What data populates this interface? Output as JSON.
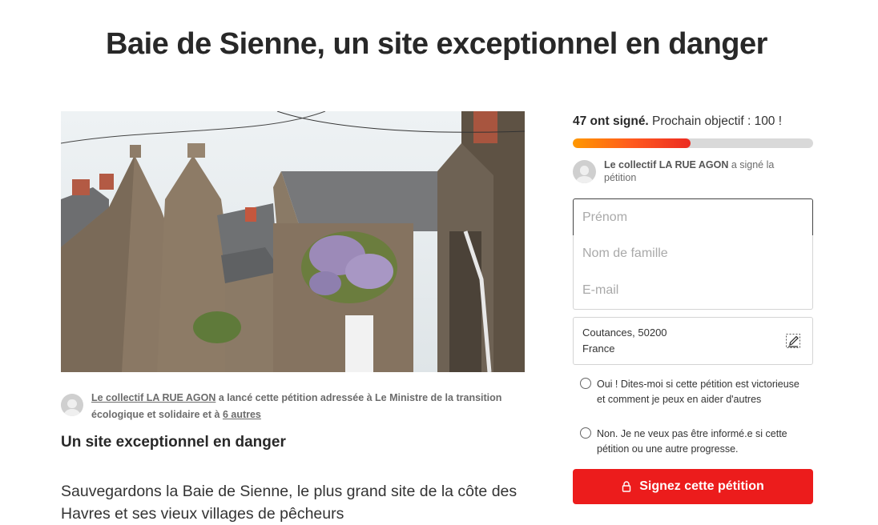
{
  "page": {
    "title": "Baie de Sienne, un site exceptionnel en danger"
  },
  "petition": {
    "starter_name": "Le collectif LA RUE AGON",
    "starter_text_mid": " a lancé cette pétition adressée à Le Ministre de la transition écologique et solidaire et à ",
    "starter_others": "6 autres",
    "subtitle": "Un site exceptionnel en danger",
    "body": "Sauvegardons la Baie de Sienne, le plus grand site de la côte des Havres et ses vieux villages de pêcheurs"
  },
  "signatures": {
    "count_label": "47 ont signé.",
    "goal_label": " Prochain objectif : 100 !",
    "progress": 0.49,
    "recent_name": "Le collectif LA RUE AGON",
    "recent_action": " a signé la pétition"
  },
  "form": {
    "first_name_placeholder": "Prénom",
    "last_name_placeholder": "Nom de famille",
    "email_placeholder": "E-mail",
    "location_line1": "Coutances, 50200",
    "location_line2": "France",
    "opt_in_label": "Oui ! Dites-moi si cette pétition est victorieuse et comment je peux en aider d'autres",
    "opt_out_label": "Non. Je ne veux pas être informé.e si cette pétition ou une autre progresse.",
    "submit_label": "Signez cette pétition"
  },
  "icons": {
    "edit": "pencil-edit-icon",
    "lock": "lock-icon",
    "avatar": "default-user-avatar"
  },
  "colors": {
    "accent": "#ec1c1c",
    "progress_start": "#ff9800",
    "progress_end": "#ec2c22"
  }
}
